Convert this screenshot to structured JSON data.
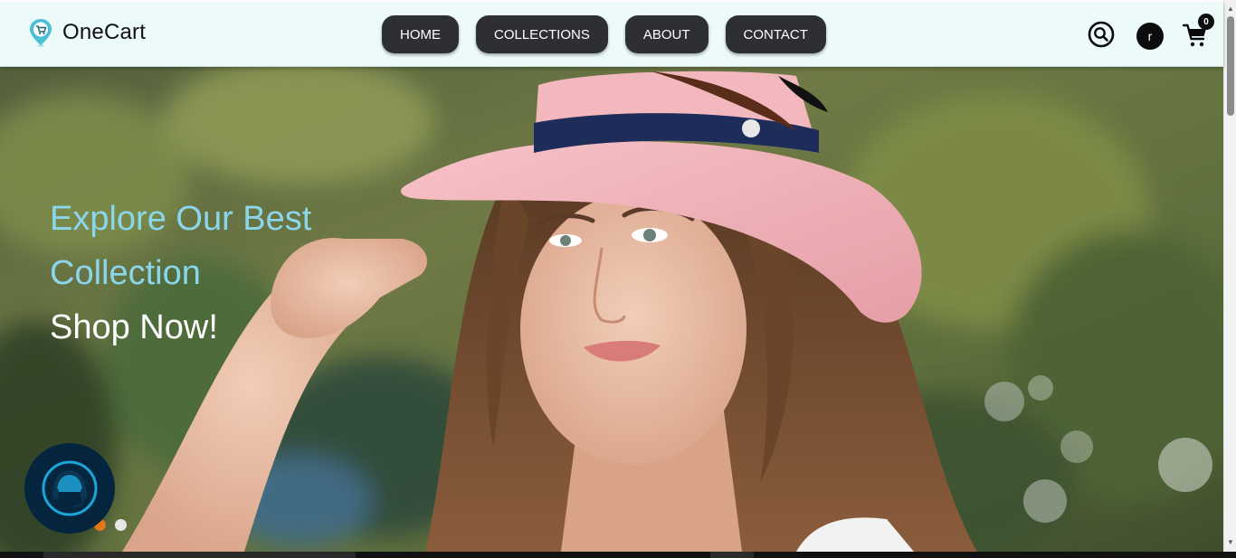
{
  "brand": {
    "name": "OneCart",
    "logo_icon": "cart-pin-logo-icon"
  },
  "nav": {
    "links": [
      {
        "label": "HOME"
      },
      {
        "label": "COLLECTIONS"
      },
      {
        "label": "ABOUT"
      },
      {
        "label": "CONTACT"
      }
    ]
  },
  "header_actions": {
    "search_icon": "search-icon",
    "avatar_initial": "r",
    "cart_icon": "cart-icon",
    "cart_count": "0"
  },
  "hero": {
    "line1": "Explore Our Best",
    "line2": "Collection",
    "line3": "Shop Now!",
    "slides_total": 2,
    "active_slide": 1
  },
  "support_widget": {
    "icon": "headset-support-icon"
  },
  "colors": {
    "nav_bg": "#ecfafa",
    "nav_button": "#2e2f33",
    "hero_accent_text": "#8ad7ec",
    "active_dot": "#e2761a",
    "support_bg": "#04253d"
  }
}
